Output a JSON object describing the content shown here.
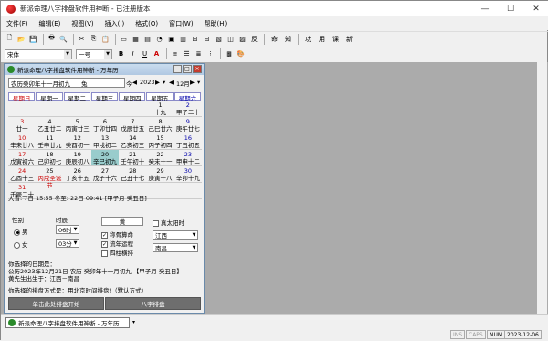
{
  "window": {
    "title": "新派命理八字排盘软件用神断 - 已注册版本"
  },
  "menu": [
    "文件(F)",
    "编辑(E)",
    "视图(V)",
    "插入(I)",
    "格式(O)",
    "窗口(W)",
    "帮助(H)"
  ],
  "toolbar": {
    "format_labels": [
      "I",
      "U",
      "A"
    ],
    "extra_labels": [
      "命",
      "知",
      "功",
      "用",
      "课",
      "新"
    ],
    "font_value": "宋体",
    "size_value": "一号",
    "bold": "B",
    "reverse": "反"
  },
  "child": {
    "title": "新派命理八字排盘软件用神断 - 万年历",
    "lunar_label": "农历癸卯年十一月初九",
    "zodiac": "兔",
    "today": "今",
    "year": "2023",
    "month": "12月",
    "weekdays": [
      "星期日",
      "星期一",
      "星期二",
      "星期三",
      "星期四",
      "星期五",
      "星期六"
    ],
    "weeks": [
      [
        {
          "d": "",
          "l": ""
        },
        {
          "d": "",
          "l": ""
        },
        {
          "d": "",
          "l": ""
        },
        {
          "d": "",
          "l": ""
        },
        {
          "d": "",
          "l": ""
        },
        {
          "d": "1",
          "l": "十九"
        },
        {
          "d": "2",
          "l": "甲子二十"
        }
      ],
      [
        {
          "d": "3",
          "l": "廿一"
        },
        {
          "d": "4",
          "l": "乙丑廿二"
        },
        {
          "d": "5",
          "l": "丙寅廿三"
        },
        {
          "d": "6",
          "l": "丁卯廿四"
        },
        {
          "d": "7",
          "l": "戊辰廿五"
        },
        {
          "d": "8",
          "l": "己巳廿六"
        },
        {
          "d": "9",
          "l": "庚午廿七"
        }
      ],
      [
        {
          "d": "10",
          "l": "辛未廿八"
        },
        {
          "d": "11",
          "l": "壬申廿九"
        },
        {
          "d": "12",
          "l": "癸酉初一"
        },
        {
          "d": "13",
          "l": "甲戌初二"
        },
        {
          "d": "14",
          "l": "乙亥初三"
        },
        {
          "d": "15",
          "l": "丙子初四"
        },
        {
          "d": "16",
          "l": "丁丑初五"
        }
      ],
      [
        {
          "d": "17",
          "l": "戊寅初六"
        },
        {
          "d": "18",
          "l": "己卯初七"
        },
        {
          "d": "19",
          "l": "庚辰初八"
        },
        {
          "d": "20",
          "l": "辛巳初九"
        },
        {
          "d": "21",
          "l": "壬午初十"
        },
        {
          "d": "22",
          "l": "癸未十一"
        },
        {
          "d": "23",
          "l": "甲申十二"
        }
      ],
      [
        {
          "d": "24",
          "l": "乙酉十三"
        },
        {
          "d": "25",
          "l": "丙戌圣诞节"
        },
        {
          "d": "26",
          "l": "丁亥十五"
        },
        {
          "d": "27",
          "l": "戊子十六"
        },
        {
          "d": "28",
          "l": "己丑十七"
        },
        {
          "d": "29",
          "l": "庚寅十八"
        },
        {
          "d": "30",
          "l": "辛卯十九"
        }
      ],
      [
        {
          "d": "31",
          "l": "壬辰二十"
        },
        {
          "d": "",
          "l": ""
        },
        {
          "d": "",
          "l": ""
        },
        {
          "d": "",
          "l": ""
        },
        {
          "d": "",
          "l": ""
        },
        {
          "d": "",
          "l": ""
        },
        {
          "d": "",
          "l": ""
        }
      ]
    ],
    "info": "大雪: 7日 15:55   冬至: 22日 09:41   [甲子月 癸丑日]",
    "gender_label": "性别",
    "male": "男",
    "female": "女",
    "time_label": "时辰",
    "hour": "06时",
    "minute": "03分",
    "name_value": "黄",
    "solar_time": "真太阳时",
    "opt1": "称骨算命",
    "opt2": "流年运程",
    "opt3": "四柱横排",
    "province": "江西",
    "city": "南昌",
    "selected_label": "你选择的日期是：",
    "selected_line": "公历2023年12月21日  农历 癸卯年十一月初九 【甲子月 癸丑日】",
    "birth_line": "黄先生出生于：江西－南昌",
    "method_line": "你选择的排盘方式是：用北京时间排盘!（默认方式）",
    "btn1": "单击此处排盘开始",
    "btn2": "八字排盘"
  },
  "taskbar": {
    "tab_label": "新派命理八字排盘软件用神断 - 万年历"
  },
  "status": {
    "ins": "INS",
    "caps": "CAPS",
    "num": "NUM",
    "date": "2023-12-06"
  }
}
